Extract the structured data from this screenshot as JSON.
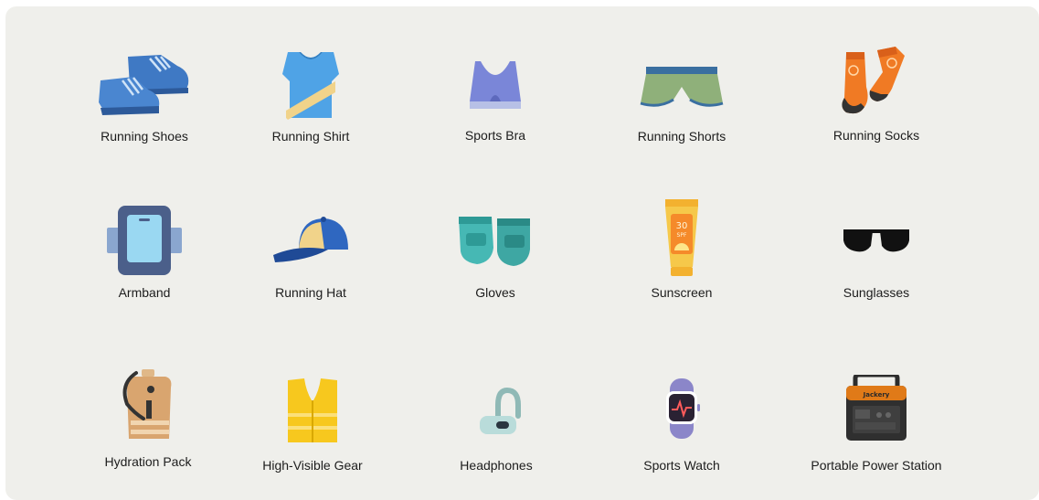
{
  "items": [
    {
      "label": "Running Shoes",
      "icon": "running-shoes-icon"
    },
    {
      "label": "Running Shirt",
      "icon": "running-shirt-icon"
    },
    {
      "label": "Sports Bra",
      "icon": "sports-bra-icon"
    },
    {
      "label": "Running Shorts",
      "icon": "running-shorts-icon"
    },
    {
      "label": "Running Socks",
      "icon": "running-socks-icon"
    },
    {
      "label": "Armband",
      "icon": "armband-icon"
    },
    {
      "label": "Running Hat",
      "icon": "running-hat-icon"
    },
    {
      "label": "Gloves",
      "icon": "gloves-icon"
    },
    {
      "label": "Sunscreen",
      "icon": "sunscreen-icon"
    },
    {
      "label": "Sunglasses",
      "icon": "sunglasses-icon"
    },
    {
      "label": "Hydration Pack",
      "icon": "hydration-pack-icon"
    },
    {
      "label": "High-Visible Gear",
      "icon": "high-visibility-vest-icon"
    },
    {
      "label": "Headphones",
      "icon": "headphones-icon"
    },
    {
      "label": "Sports Watch",
      "icon": "sports-watch-icon"
    },
    {
      "label": "Portable Power Station",
      "icon": "portable-power-station-icon"
    }
  ],
  "sunscreen_text": {
    "spf": "30",
    "unit": "SPF"
  },
  "power_station_brand": "Jackery",
  "colors": {
    "background": "#efefeb",
    "shoe_blue": "#3f79c4",
    "shirt_blue": "#4fa3e6",
    "shirt_stripe": "#f1d38a",
    "bra_purple": "#7a86d8",
    "shorts_green": "#8fb07a",
    "socks_orange": "#f07a24",
    "armband_navy": "#4b5f8a",
    "hat_blue": "#2f67c0",
    "gloves_teal": "#46b8b4",
    "sunscreen_yellow": "#f6c84a",
    "vest_yellow": "#f7c81e",
    "watch_purple": "#8b86c9",
    "power_orange": "#e07a18"
  }
}
